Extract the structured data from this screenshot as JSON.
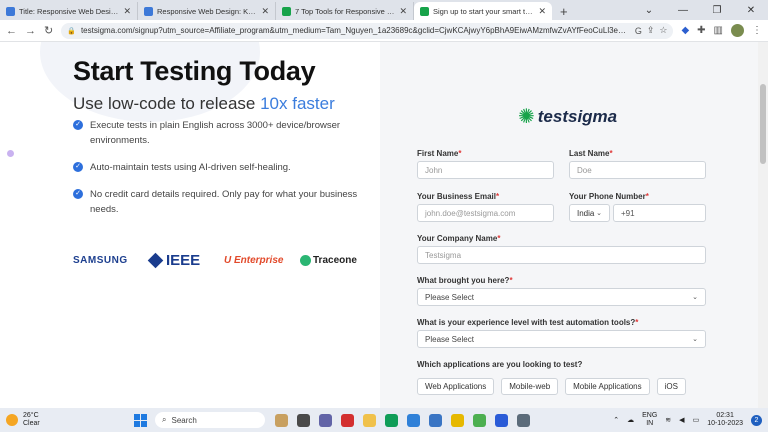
{
  "browser": {
    "tabs": [
      {
        "title": "Title: Responsive Web Design: K",
        "color": "#3d79d8"
      },
      {
        "title": "Responsive Web Design: Key Ele",
        "color": "#3d79d8"
      },
      {
        "title": "7 Top Tools for Responsive Web",
        "color": "#17a34a"
      },
      {
        "title": "Sign up to start your smart test",
        "color": "#17a34a"
      }
    ],
    "new_tab": "+",
    "url": "testsigma.com/signup?utm_source=Affiliate_program&utm_medium=Tam_Nguyen_1a23689c&gclid=CjwKCAjwyY6pBhA9EiwAMzmfwZvAYfFeoCuLl3eec..."
  },
  "hero": {
    "title": "Start Testing Today",
    "subtitle_prefix": "Use low-code to release ",
    "subtitle_highlight": "10x faster",
    "benefits": [
      "Execute tests in plain English across 3000+ device/browser environments.",
      "Auto-maintain tests using AI-driven self-healing.",
      "No credit card details required. Only pay for what your business needs."
    ]
  },
  "logos": {
    "samsung": "SAMSUNG",
    "ieee": "IEEE",
    "enterprise": "Enterprise",
    "traceone": "Traceone"
  },
  "form": {
    "brand": "testsigma",
    "first_name_label": "First Name",
    "first_name_placeholder": "John",
    "last_name_label": "Last Name",
    "last_name_placeholder": "Doe",
    "email_label": "Your Business Email",
    "email_placeholder": "john.doe@testsigma.com",
    "phone_label": "Your Phone Number",
    "phone_country": "India",
    "phone_code": "+91",
    "company_label": "Your Company Name",
    "company_placeholder": "Testsigma",
    "reason_label": "What brought you here?",
    "reason_value": "Please Select",
    "experience_label": "What is your experience level with test automation tools?",
    "experience_value": "Please Select",
    "apps_label": "Which applications are you looking to test?",
    "apps": [
      "Web Applications",
      "Mobile-web",
      "Mobile Applications",
      "iOS"
    ],
    "required_mark": "*"
  },
  "taskbar": {
    "temperature": "26°C",
    "condition": "Clear",
    "search": "Search",
    "lang_top": "ENG",
    "lang_bottom": "IN",
    "time": "02:31",
    "date": "10-10-2023",
    "notifications": "2"
  }
}
